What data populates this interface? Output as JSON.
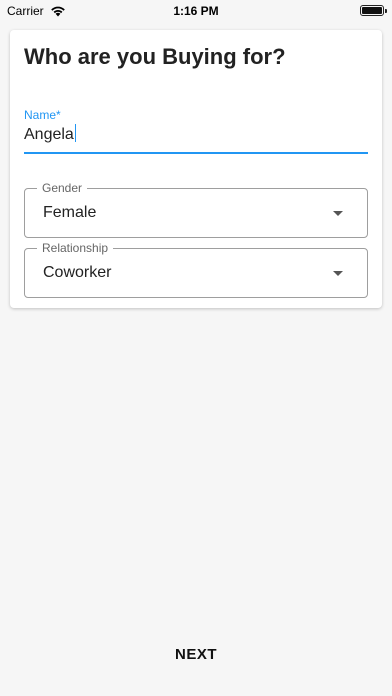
{
  "status_bar": {
    "carrier": "Carrier",
    "time": "1:16 PM",
    "wifi_icon": "wifi-icon",
    "battery_icon": "battery-icon"
  },
  "card": {
    "title": "Who are you Buying for?",
    "name_field": {
      "label": "Name*",
      "value": "Angela",
      "accent": "#2196f3"
    },
    "gender_select": {
      "label": "Gender",
      "selected": "Female"
    },
    "relationship_select": {
      "label": "Relationship",
      "selected": "Coworker"
    }
  },
  "footer": {
    "next_label": "NEXT"
  }
}
